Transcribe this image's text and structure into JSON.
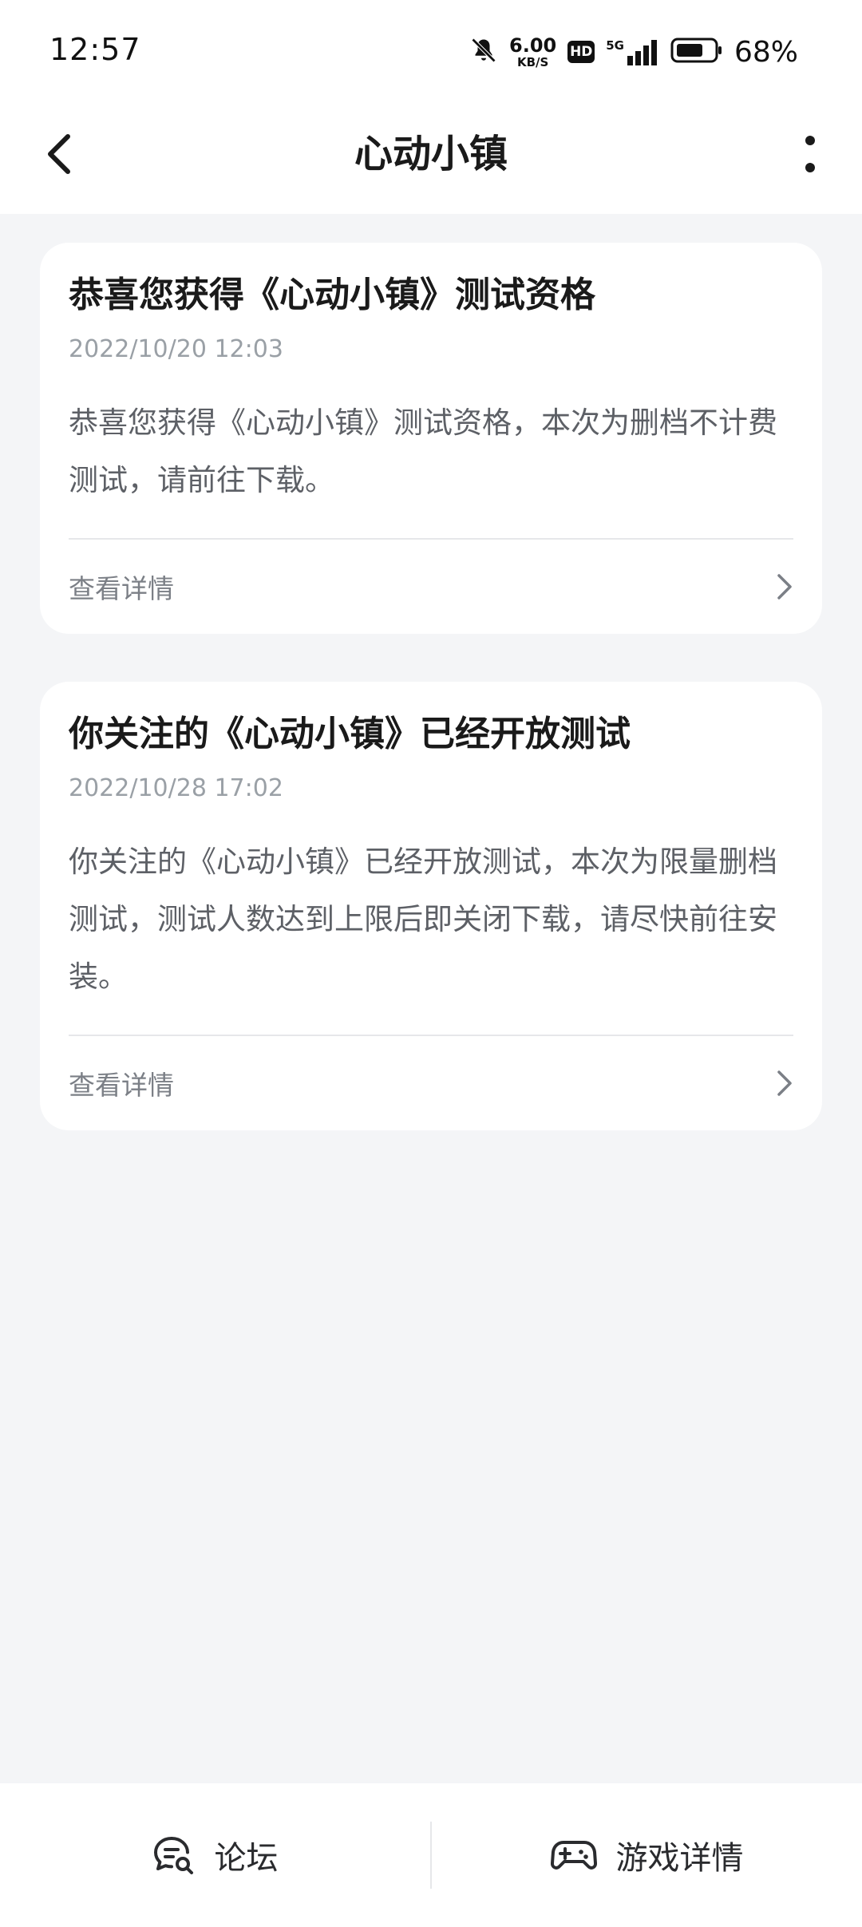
{
  "status_bar": {
    "time": "12:57",
    "net_speed_value": "6.00",
    "net_speed_unit": "KB/S",
    "hd_badge": "HD",
    "network_label": "5G",
    "battery_percent": "68%",
    "icons": [
      "mute-bell-icon",
      "signal-icon",
      "battery-icon"
    ]
  },
  "header": {
    "title": "心动小镇",
    "icons": [
      "back-icon",
      "more-icon"
    ]
  },
  "cards": [
    {
      "title": "恭喜您获得《心动小镇》测试资格",
      "time": "2022/10/20 12:03",
      "body": "恭喜您获得《心动小镇》测试资格，本次为删档不计费测试，请前往下载。",
      "footer_label": "查看详情"
    },
    {
      "title": "你关注的《心动小镇》已经开放测试",
      "time": "2022/10/28 17:02",
      "body": "你关注的《心动小镇》已经开放测试，本次为限量删档测试，测试人数达到上限后即关闭下载，请尽快前往安装。",
      "footer_label": "查看详情"
    }
  ],
  "bottom_bar": {
    "forum_label": "论坛",
    "game_detail_label": "游戏详情",
    "icons": [
      "forum-icon",
      "gamepad-icon"
    ]
  },
  "colors": {
    "background": "#f4f5f7",
    "card": "#ffffff",
    "text_primary": "#1a1a1a",
    "text_secondary": "#5d6066",
    "text_muted": "#9aa0a6"
  }
}
